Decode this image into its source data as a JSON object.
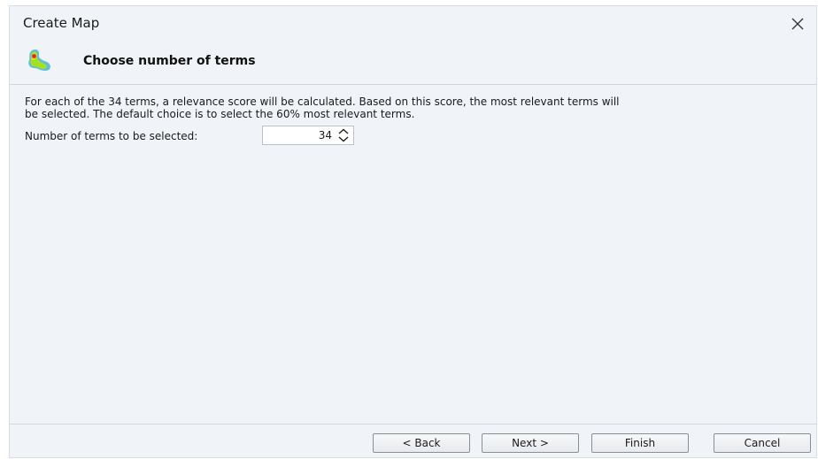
{
  "window": {
    "title": "Create Map"
  },
  "header": {
    "title": "Choose number of terms"
  },
  "body": {
    "description_line1": "For each of the 34 terms, a relevance score will be calculated. Based on this score, the most relevant terms will",
    "description_line2": "be selected. The default choice is to select the 60% most relevant terms.",
    "count_label": "Number of terms to be selected:",
    "count_value": "34"
  },
  "buttons": {
    "back": "< Back",
    "next": "Next >",
    "finish": "Finish",
    "cancel": "Cancel"
  },
  "icons": {
    "logo": "vosviewer-density-logo-icon",
    "close": "close-icon",
    "spinner": "up-down-chevron-icon"
  },
  "colors": {
    "background": "#f0f4f9",
    "logo_outer": "#5fc0dc",
    "logo_mid": "#a7e01f",
    "logo_hot": "#e8e600",
    "logo_core": "#e8262a"
  }
}
